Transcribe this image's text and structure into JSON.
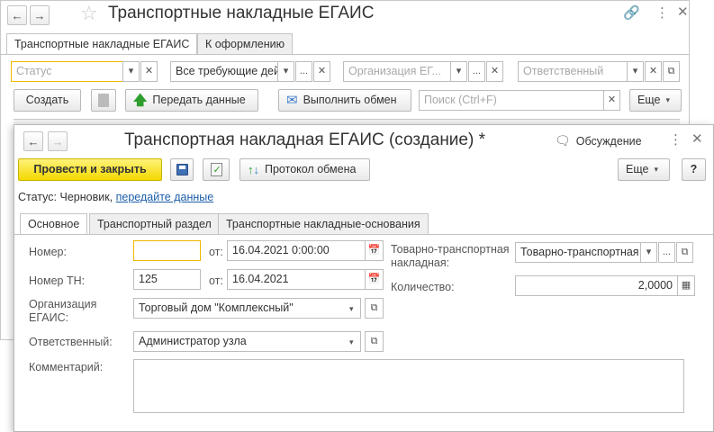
{
  "back_window": {
    "title": "Транспортные накладные ЕГАИС",
    "tabs": [
      "Транспортные накладные ЕГАИС",
      "К оформлению"
    ],
    "filters": {
      "status_placeholder": "Статус",
      "requirement_value": "Все требующие дей",
      "organization_placeholder": "Организация ЕГ...",
      "responsible_placeholder": "Ответственный"
    },
    "toolbar": {
      "create_label": "Создать",
      "send_data_label": "Передать данные",
      "exchange_label": "Выполнить обмен",
      "search_placeholder": "Поиск (Ctrl+F)",
      "more_label": "Еще"
    }
  },
  "front_window": {
    "title": "Транспортная накладная ЕГАИС (создание) *",
    "discussion_label": "Обсуждение",
    "toolbar": {
      "post_close_label": "Провести и закрыть",
      "exchange_log_label": "Протокол обмена",
      "more_label": "Еще",
      "help_label": "?"
    },
    "status": {
      "prefix": "Статус:",
      "value": "Черновик,",
      "link": "передайте данные"
    },
    "tabs": [
      "Основное",
      "Транспортный раздел",
      "Транспортные накладные-основания"
    ],
    "form": {
      "number_label": "Номер:",
      "number_value": "",
      "from_label": "от:",
      "number_date": "16.04.2021  0:00:00",
      "tn_number_label": "Номер ТН:",
      "tn_number_value": "125",
      "tn_date": "16.04.2021",
      "org_label": "Организация ЕГАИС:",
      "org_value": "Торговый дом \"Комплексный\"",
      "responsible_label": "Ответственный:",
      "responsible_value": "Администратор узла",
      "comment_label": "Комментарий:",
      "waybill_label": "Товарно-транспортная накладная:",
      "waybill_value": "Товарно-транспортная",
      "quantity_label": "Количество:",
      "quantity_value": "2,0000"
    }
  },
  "colors": {
    "primary_button": "#f3d800",
    "link": "#1b5ea8",
    "highlight_border": "#f0b800"
  }
}
